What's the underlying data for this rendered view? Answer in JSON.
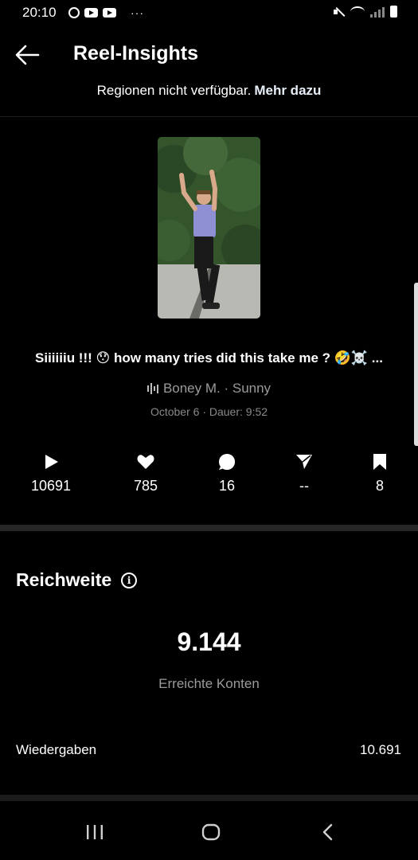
{
  "status_bar": {
    "time": "20:10",
    "more": "···"
  },
  "header": {
    "title": "Reel-Insights",
    "back_icon": "arrow-left-icon"
  },
  "notice": {
    "text": "Regionen nicht verfügbar.",
    "link": "Mehr dazu"
  },
  "reel": {
    "caption": "Siiiiiiu !!! 😯 how many tries did this take me ? 🤣☠️ ...",
    "audio": "Boney M. · Sunny",
    "meta": "October 6 · Dauer: 9:52"
  },
  "stats": [
    {
      "icon": "play-icon",
      "value": "10691"
    },
    {
      "icon": "heart-icon",
      "value": "785"
    },
    {
      "icon": "comment-icon",
      "value": "16"
    },
    {
      "icon": "share-icon",
      "value": "--"
    },
    {
      "icon": "bookmark-icon",
      "value": "8"
    }
  ],
  "reach": {
    "title": "Reichweite",
    "accounts_reached": "9.144",
    "accounts_reached_label": "Erreichte Konten",
    "plays_label": "Wiedergaben",
    "plays_value": "10.691"
  },
  "colors": {
    "background": "#000000",
    "muted_text": "#9a9a9a",
    "divider": "#262626"
  }
}
